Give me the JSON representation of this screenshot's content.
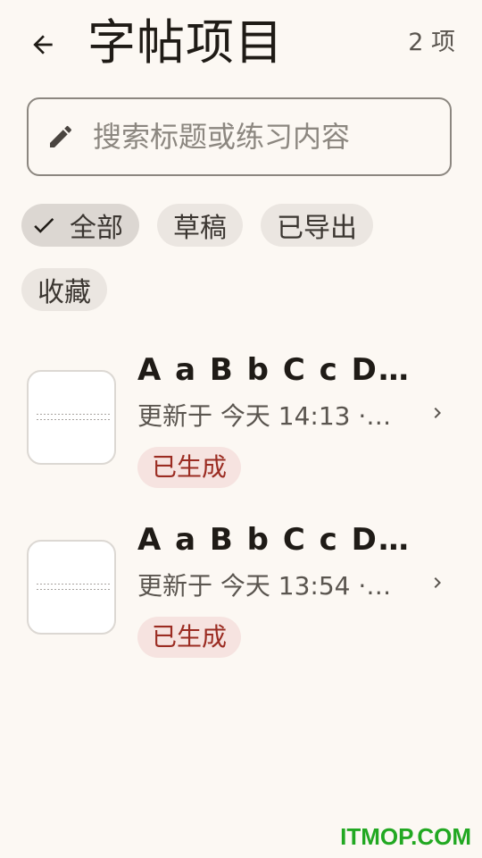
{
  "header": {
    "back_icon": "arrow-left-icon",
    "title": "字帖项目",
    "count": "2 项"
  },
  "search": {
    "icon": "pencil-icon",
    "value": "",
    "placeholder": "搜索标题或练习内容"
  },
  "filters": {
    "selected": "全部",
    "chips": [
      {
        "label": "全部",
        "selected": true
      },
      {
        "label": "草稿",
        "selected": false
      },
      {
        "label": "已导出",
        "selected": false
      },
      {
        "label": "收藏",
        "selected": false
      }
    ]
  },
  "items": [
    {
      "title": "A a B b C c D d …",
      "subtitle": "更新于 今天 14:13 ·…",
      "status": "已生成"
    },
    {
      "title": "A a B b C c D d …",
      "subtitle": "更新于 今天 13:54 ·…",
      "status": "已生成"
    }
  ],
  "watermark": "ITMOP.COM",
  "colors": {
    "background": "#fcf8f3",
    "chip": "#ebe6e1",
    "chip_selected": "#dcd7d2",
    "badge_bg": "#f6e3e0",
    "badge_text": "#9b2c22",
    "watermark": "#22a822"
  }
}
